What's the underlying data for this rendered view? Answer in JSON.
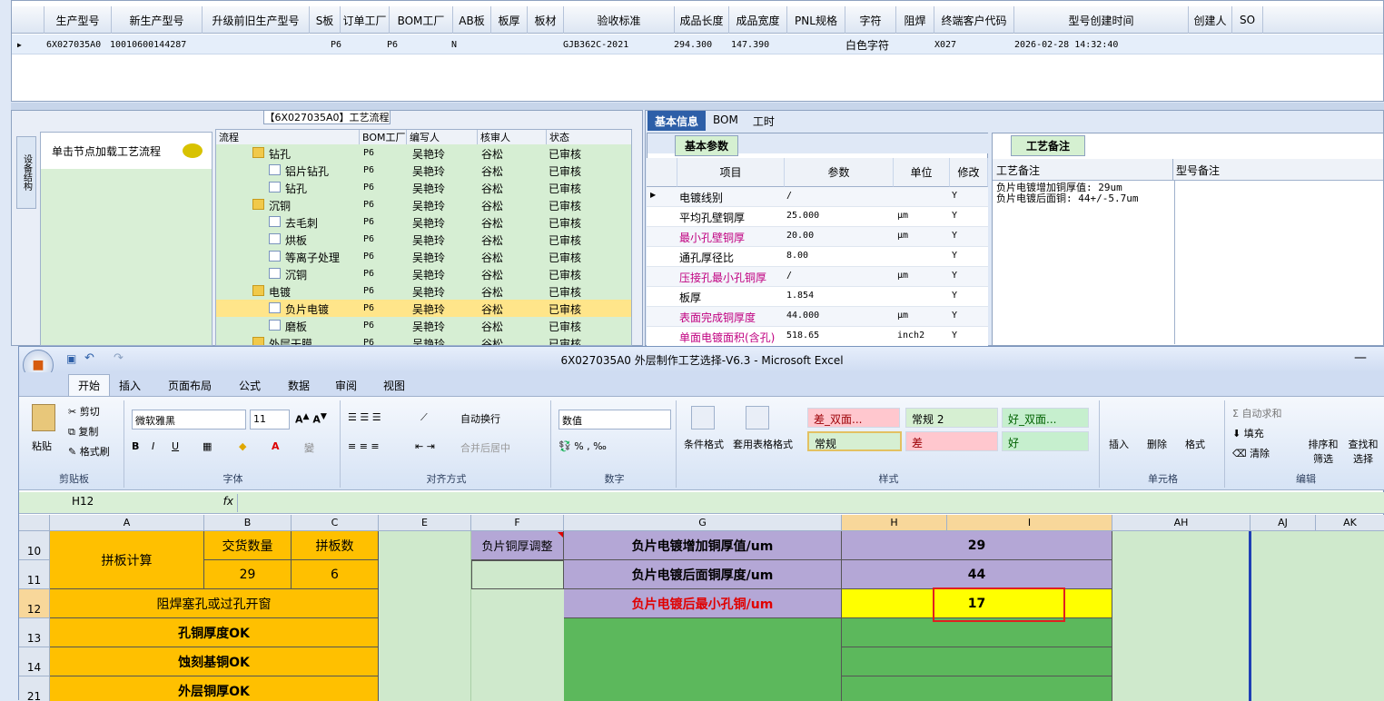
{
  "top_grid": {
    "headers": [
      "生产型号",
      "新生产型号",
      "升级前旧生产型号",
      "S板",
      "订单工厂",
      "BOM工厂",
      "AB板",
      "板厚",
      "板材",
      "验收标准",
      "成品长度",
      "成品宽度",
      "PNL规格",
      "字符",
      "阻焊",
      "终端客户代码",
      "型号创建时间",
      "创建人",
      "SO"
    ],
    "row": {
      "prod_model": "6X027035A0",
      "new_model": "10010600144287",
      "order_factory": "P6",
      "bom_factory": "P6",
      "ab": "N",
      "standard": "GJB362C-2021",
      "length": "294.300",
      "width": "147.390",
      "char": "白色字符",
      "customer": "X027",
      "created": "2026-02-28 14:32:40"
    }
  },
  "flow_panel": {
    "title": "【6X027035A0】工艺流程",
    "side_tab": "设备结构",
    "node_hint": "单击节点加载工艺流程",
    "tree_headers": [
      "流程",
      "BOM工厂",
      "编写人",
      "核审人",
      "状态"
    ],
    "rows": [
      {
        "name": "钻孔",
        "folder": true,
        "level": 0,
        "bom": "P6",
        "writer": "吴艳玲",
        "reviewer": "谷松",
        "status": "已审核"
      },
      {
        "name": "铝片钻孔",
        "folder": false,
        "level": 1,
        "bom": "P6",
        "writer": "吴艳玲",
        "reviewer": "谷松",
        "status": "已审核"
      },
      {
        "name": "钻孔",
        "folder": false,
        "level": 1,
        "bom": "P6",
        "writer": "吴艳玲",
        "reviewer": "谷松",
        "status": "已审核"
      },
      {
        "name": "沉铜",
        "folder": true,
        "level": 0,
        "bom": "P6",
        "writer": "吴艳玲",
        "reviewer": "谷松",
        "status": "已审核"
      },
      {
        "name": "去毛刺",
        "folder": false,
        "level": 1,
        "bom": "P6",
        "writer": "吴艳玲",
        "reviewer": "谷松",
        "status": "已审核"
      },
      {
        "name": "烘板",
        "folder": false,
        "level": 1,
        "bom": "P6",
        "writer": "吴艳玲",
        "reviewer": "谷松",
        "status": "已审核"
      },
      {
        "name": "等离子处理",
        "folder": false,
        "level": 1,
        "bom": "P6",
        "writer": "吴艳玲",
        "reviewer": "谷松",
        "status": "已审核"
      },
      {
        "name": "沉铜",
        "folder": false,
        "level": 1,
        "bom": "P6",
        "writer": "吴艳玲",
        "reviewer": "谷松",
        "status": "已审核"
      },
      {
        "name": "电镀",
        "folder": true,
        "level": 0,
        "bom": "P6",
        "writer": "吴艳玲",
        "reviewer": "谷松",
        "status": "已审核"
      },
      {
        "name": "负片电镀",
        "folder": false,
        "level": 1,
        "bom": "P6",
        "writer": "吴艳玲",
        "reviewer": "谷松",
        "status": "已审核",
        "selected": true
      },
      {
        "name": "磨板",
        "folder": false,
        "level": 1,
        "bom": "P6",
        "writer": "吴艳玲",
        "reviewer": "谷松",
        "status": "已审核"
      },
      {
        "name": "外层干膜",
        "folder": true,
        "level": 0,
        "bom": "P6",
        "writer": "吴艳玲",
        "reviewer": "谷松",
        "status": "已审核"
      }
    ]
  },
  "info_panel": {
    "tabs": [
      "基本信息",
      "BOM",
      "工时"
    ],
    "basic_tab": "基本参数",
    "param_headers": [
      "项目",
      "参数",
      "单位",
      "修改"
    ],
    "params": [
      {
        "item": "电镀线别",
        "value": "/",
        "unit": "",
        "mod": "Y",
        "red": false
      },
      {
        "item": "平均孔壁铜厚",
        "value": "25.000",
        "unit": "μm",
        "mod": "Y",
        "red": false
      },
      {
        "item": "最小孔壁铜厚",
        "value": "20.00",
        "unit": "μm",
        "mod": "Y",
        "red": true
      },
      {
        "item": "通孔厚径比",
        "value": "8.00",
        "unit": "",
        "mod": "Y",
        "red": false
      },
      {
        "item": "压接孔最小孔铜厚",
        "value": "/",
        "unit": "μm",
        "mod": "Y",
        "red": true
      },
      {
        "item": "板厚",
        "value": "1.854",
        "unit": "",
        "mod": "Y",
        "red": false
      },
      {
        "item": "表面完成铜厚度",
        "value": "44.000",
        "unit": "μm",
        "mod": "Y",
        "red": true
      },
      {
        "item": "单面电镀面积(含孔)",
        "value": "518.65",
        "unit": "inch2",
        "mod": "Y",
        "red": true
      }
    ],
    "remarks_tab": "工艺备注",
    "remark_headers": [
      "工艺备注",
      "型号备注"
    ],
    "remark_lines": [
      "负片电镀增加铜厚值: 29um",
      "负片电镀后面铜: 44+/-5.7um"
    ]
  },
  "excel": {
    "title": "6X027035A0 外层制作工艺选择-V6.3 - Microsoft Excel",
    "tabs": [
      "开始",
      "插入",
      "页面布局",
      "公式",
      "数据",
      "审阅",
      "视图"
    ],
    "clipboard": {
      "paste": "粘贴",
      "cut": "剪切",
      "copy": "复制",
      "painter": "格式刷",
      "label": "剪贴板"
    },
    "font": {
      "name": "微软雅黑",
      "size": "11",
      "label": "字体"
    },
    "align": {
      "wrap": "自动换行",
      "merge": "合并后居中",
      "label": "对齐方式"
    },
    "number": {
      "format": "数值",
      "label": "数字"
    },
    "styles": {
      "cond": "条件格式",
      "table": "套用表格格式",
      "cells": [
        "差_双面...",
        "常规 2",
        "好_双面...",
        "常规",
        "差",
        "好"
      ],
      "label": "样式"
    },
    "cells_group": {
      "insert": "插入",
      "delete": "删除",
      "format": "格式",
      "label": "单元格"
    },
    "edit": {
      "autosum": "自动求和",
      "fill": "填充",
      "clear": "清除",
      "sort": "排序和筛选",
      "find": "查找和选择",
      "label": "编辑"
    },
    "namebox": "H12",
    "fx": "fx",
    "columns": [
      "A",
      "B",
      "C",
      "E",
      "F",
      "G",
      "H",
      "I",
      "AH",
      "AJ",
      "AK"
    ],
    "rownums": [
      "10",
      "11",
      "12",
      "13",
      "14",
      "21"
    ],
    "cells": {
      "a10": "拼板计算",
      "b10": "交货数量",
      "c10": "拼板数",
      "b11": "29",
      "c11": "6",
      "f10": "负片铜厚调整",
      "g10": "负片电镀增加铜厚值/um",
      "hi10": "29",
      "g11": "负片电镀后面铜厚度/um",
      "hi11": "44",
      "a12": "阻焊塞孔或过孔开窗",
      "g12": "负片电镀后最小孔铜/um",
      "hi12": "17",
      "a13": "孔铜厚度OK",
      "a14": "蚀刻基铜OK",
      "a21": "外层铜厚OK"
    }
  }
}
